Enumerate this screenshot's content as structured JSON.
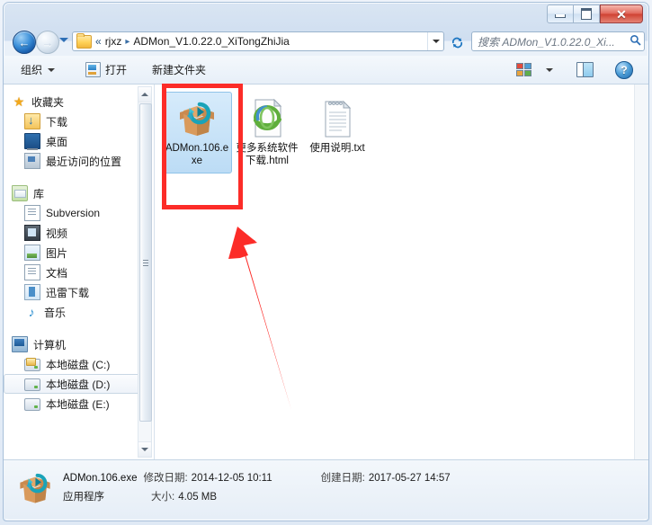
{
  "window": {
    "controls": {
      "minimize": "—",
      "maximize": "❐",
      "close": "✕"
    }
  },
  "nav": {
    "back_glyph": "←",
    "forward_glyph": "→",
    "history_dropdown": "history-dropdown"
  },
  "address": {
    "separator_double": "«",
    "crumbs": [
      "rjxz",
      "ADMon_V1.0.22.0_XiTongZhiJia"
    ],
    "arrow": "▸",
    "dropdown": "address-dropdown",
    "refresh_glyph": "↻"
  },
  "search": {
    "placeholder": "搜索 ADMon_V1.0.22.0_Xi...",
    "icon": "search-icon"
  },
  "toolbar": {
    "organize": "组织",
    "open": "打开",
    "new_folder": "新建文件夹",
    "views_icon": "views-icon",
    "views_caret": "views-caret",
    "preview_pane_icon": "preview-pane-icon",
    "help_icon": "?"
  },
  "sidebar": {
    "items": [
      {
        "label": "收藏夹",
        "icon": "star-icon",
        "type": "header"
      },
      {
        "label": "下载",
        "icon": "downloads-icon",
        "type": "child"
      },
      {
        "label": "桌面",
        "icon": "desktop-icon",
        "type": "child"
      },
      {
        "label": "最近访问的位置",
        "icon": "recent-places-icon",
        "type": "child"
      },
      {
        "label": "库",
        "icon": "library-icon",
        "type": "header"
      },
      {
        "label": "Subversion",
        "icon": "document-icon",
        "type": "child"
      },
      {
        "label": "视频",
        "icon": "video-icon",
        "type": "child"
      },
      {
        "label": "图片",
        "icon": "pictures-icon",
        "type": "child"
      },
      {
        "label": "文档",
        "icon": "documents-icon",
        "type": "child"
      },
      {
        "label": "迅雷下载",
        "icon": "thunder-download-icon",
        "type": "child"
      },
      {
        "label": "音乐",
        "icon": "music-icon",
        "type": "child"
      },
      {
        "label": "计算机",
        "icon": "computer-icon",
        "type": "header"
      },
      {
        "label": "本地磁盘 (C:)",
        "icon": "system-drive-icon",
        "type": "child"
      },
      {
        "label": "本地磁盘 (D:)",
        "icon": "drive-icon",
        "type": "child",
        "selected": true
      },
      {
        "label": "本地磁盘 (E:)",
        "icon": "drive-icon",
        "type": "child"
      }
    ]
  },
  "files": [
    {
      "name": "ADMon.106.exe",
      "icon": "admon-box-icon",
      "selected": true
    },
    {
      "name": "更多系统软件下载.html",
      "icon": "ie-html-icon",
      "selected": false
    },
    {
      "name": "使用说明.txt",
      "icon": "text-file-icon",
      "selected": false
    }
  ],
  "status": {
    "file_name": "ADMon.106.exe",
    "modified_label": "修改日期:",
    "modified_value": "2014-12-05 10:11",
    "created_label": "创建日期:",
    "created_value": "2017-05-27 14:57",
    "type_value": "应用程序",
    "size_label": "大小:",
    "size_value": "4.05 MB",
    "icon": "admon-box-icon"
  },
  "annotations": {
    "highlight_rect": "red-highlight-rectangle",
    "pointer_arrow": "red-pointer-arrow",
    "color": "#fc2c28"
  }
}
